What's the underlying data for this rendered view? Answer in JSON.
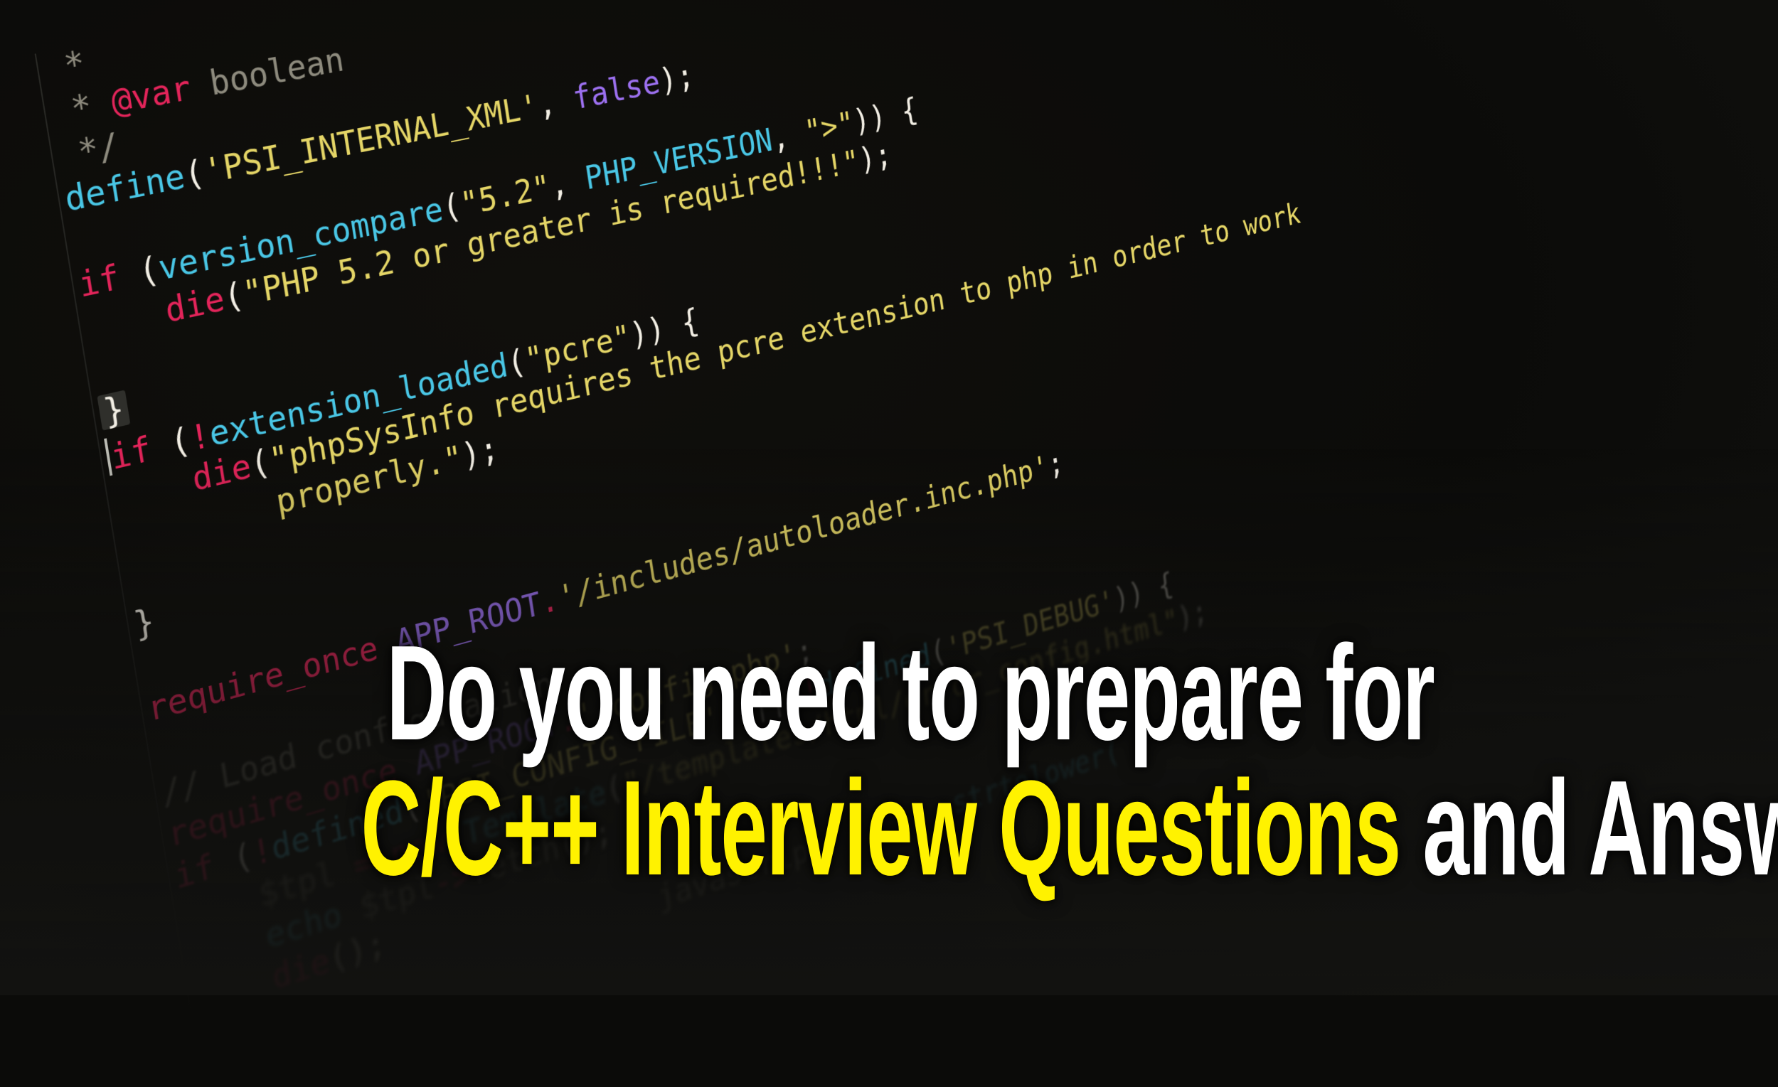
{
  "code": {
    "lines": [
      {
        "tokens": [
          {
            "t": " *",
            "c": "comment"
          }
        ]
      },
      {
        "tokens": [
          {
            "t": " * ",
            "c": "comment"
          },
          {
            "t": "@var",
            "c": "kw"
          },
          {
            "t": " boolean",
            "c": "comment"
          }
        ]
      },
      {
        "tokens": [
          {
            "t": " */",
            "c": "comment"
          }
        ]
      },
      {
        "tokens": [
          {
            "t": "define",
            "c": "fn"
          },
          {
            "t": "(",
            "c": "plain"
          },
          {
            "t": "'PSI_INTERNAL_XML'",
            "c": "str"
          },
          {
            "t": ", ",
            "c": "plain"
          },
          {
            "t": "false",
            "c": "const"
          },
          {
            "t": ");",
            "c": "plain"
          }
        ]
      },
      {
        "tokens": []
      },
      {
        "tokens": [
          {
            "t": "if",
            "c": "kw"
          },
          {
            "t": " (",
            "c": "plain"
          },
          {
            "t": "version_compare",
            "c": "fn"
          },
          {
            "t": "(",
            "c": "plain"
          },
          {
            "t": "\"5.2\"",
            "c": "str"
          },
          {
            "t": ", ",
            "c": "plain"
          },
          {
            "t": "PHP_VERSION",
            "c": "fn"
          },
          {
            "t": ", ",
            "c": "plain"
          },
          {
            "t": "\">\"",
            "c": "str"
          },
          {
            "t": ")) {",
            "c": "plain"
          }
        ]
      },
      {
        "tokens": [
          {
            "t": "    ",
            "c": "plain"
          },
          {
            "t": "die",
            "c": "kw"
          },
          {
            "t": "(",
            "c": "plain"
          },
          {
            "t": "\"PHP 5.2 or greater is required!!!\"",
            "c": "str"
          },
          {
            "t": ");",
            "c": "plain"
          }
        ]
      },
      {
        "tokens": []
      },
      {
        "tokens": [
          {
            "t": "}",
            "c": "brace"
          }
        ]
      },
      {
        "tokens": [
          {
            "t": "|",
            "c": "caret"
          },
          {
            "t": "if",
            "c": "kw"
          },
          {
            "t": " (",
            "c": "plain"
          },
          {
            "t": "!",
            "c": "kw"
          },
          {
            "t": "extension_loaded",
            "c": "fn"
          },
          {
            "t": "(",
            "c": "plain"
          },
          {
            "t": "\"pcre\"",
            "c": "str"
          },
          {
            "t": ")) {",
            "c": "plain"
          }
        ]
      },
      {
        "tokens": [
          {
            "t": "    ",
            "c": "plain"
          },
          {
            "t": "die",
            "c": "kw"
          },
          {
            "t": "(",
            "c": "plain"
          },
          {
            "t": "\"phpSysInfo requires the pcre extension to php in order to work",
            "c": "str"
          }
        ]
      },
      {
        "tokens": [
          {
            "t": "        properly.\"",
            "c": "str"
          },
          {
            "t": ");",
            "c": "plain"
          }
        ]
      },
      {
        "tokens": []
      },
      {
        "tokens": [
          {
            "t": "}",
            "c": "plain"
          }
        ]
      },
      {
        "tokens": []
      },
      {
        "tokens": [
          {
            "t": "require_once",
            "c": "kw"
          },
          {
            "t": " ",
            "c": "plain"
          },
          {
            "t": "APP_ROOT",
            "c": "const"
          },
          {
            "t": ".",
            "c": "kw"
          },
          {
            "t": "'/includes/autoloader.inc.php'",
            "c": "str"
          },
          {
            "t": ";",
            "c": "plain"
          }
        ]
      },
      {
        "tokens": []
      },
      {
        "tokens": [
          {
            "t": "// Load configuration",
            "c": "comment"
          }
        ]
      },
      {
        "tokens": [
          {
            "t": "require_once",
            "c": "kw"
          },
          {
            "t": " ",
            "c": "plain"
          },
          {
            "t": "APP_ROOT",
            "c": "const"
          },
          {
            "t": ".",
            "c": "kw"
          },
          {
            "t": "'/config.php'",
            "c": "str"
          },
          {
            "t": ";",
            "c": "plain"
          }
        ]
      },
      {
        "tokens": [
          {
            "t": "if",
            "c": "kw"
          },
          {
            "t": " (",
            "c": "plain"
          },
          {
            "t": "!",
            "c": "kw"
          },
          {
            "t": "defined",
            "c": "fn"
          },
          {
            "t": "(",
            "c": "plain"
          },
          {
            "t": "'PSI_CONFIG_FILE'",
            "c": "str"
          },
          {
            "t": ") || ",
            "c": "plain"
          },
          {
            "t": "!",
            "c": "kw"
          },
          {
            "t": "defined",
            "c": "fn"
          },
          {
            "t": "(",
            "c": "plain"
          },
          {
            "t": "'PSI_DEBUG'",
            "c": "str"
          },
          {
            "t": ")) {",
            "c": "plain"
          }
        ]
      },
      {
        "tokens": [
          {
            "t": "    ",
            "c": "plain"
          },
          {
            "t": "$tpl",
            "c": "comment"
          },
          {
            "t": " = ",
            "c": "kw"
          },
          {
            "t": "new",
            "c": "kw"
          },
          {
            "t": " ",
            "c": "plain"
          },
          {
            "t": "Template",
            "c": "fn"
          },
          {
            "t": "(",
            "c": "plain"
          },
          {
            "t": "\"/templates/html/error_config.html\"",
            "c": "str"
          },
          {
            "t": ");",
            "c": "plain"
          }
        ]
      },
      {
        "tokens": [
          {
            "t": "    ",
            "c": "plain"
          },
          {
            "t": "echo",
            "c": "fn"
          },
          {
            "t": " ",
            "c": "plain"
          },
          {
            "t": "$tpl",
            "c": "comment"
          },
          {
            "t": "->",
            "c": "kw"
          },
          {
            "t": "fetch",
            "c": "comment"
          },
          {
            "t": "();",
            "c": "plain"
          }
        ]
      },
      {
        "tokens": [
          {
            "t": "    ",
            "c": "plain"
          },
          {
            "t": "die",
            "c": "kw"
          },
          {
            "t": "();",
            "c": "plain"
          }
        ]
      },
      {
        "tokens": [
          {
            "t": "                         javascript",
            "c": "comment"
          },
          {
            "t": "        strtolower(",
            "c": "fn"
          }
        ]
      }
    ]
  },
  "headline": {
    "line1": "Do you need to prepare for",
    "line2_highlight": "C/C++ Interview Questions",
    "line2_rest": " and Answers?"
  },
  "colors": {
    "highlight": "#fff200",
    "text": "#ffffff",
    "background": "#0b0b09"
  }
}
